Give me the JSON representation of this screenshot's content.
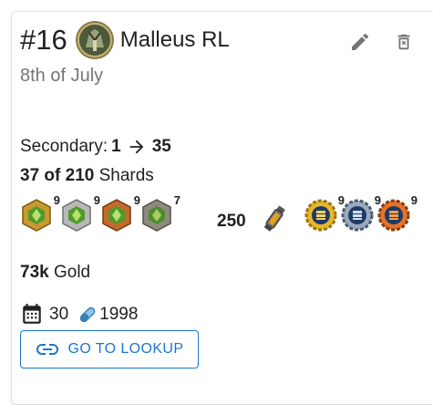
{
  "header": {
    "rank": "#16",
    "champion_name": "Malleus RL",
    "date": "8th of July"
  },
  "secondary": {
    "label": "Secondary:",
    "from": "1",
    "to": "35"
  },
  "shards": {
    "amount": "37 of 210",
    "label": "Shards"
  },
  "crystals": [
    {
      "icon": "green-gold-crystal-icon",
      "count": "9"
    },
    {
      "icon": "green-silver-crystal-icon",
      "count": "9"
    },
    {
      "icon": "green-bronze-crystal-icon",
      "count": "9"
    },
    {
      "icon": "green-iron-crystal-icon",
      "count": "7"
    }
  ],
  "token": {
    "amount": "250",
    "icon": "potion-vial-icon"
  },
  "coins": [
    {
      "icon": "gold-gear-coin-icon",
      "count": "9"
    },
    {
      "icon": "blue-gear-coin-icon",
      "count": "9"
    },
    {
      "icon": "orange-gear-coin-icon",
      "count": "9"
    }
  ],
  "gold": {
    "amount": "73k",
    "label": "Gold"
  },
  "stats": {
    "days": "30",
    "pills": "1998"
  },
  "lookup_button": "GO TO LOOKUP",
  "colors": {
    "accent": "#1976d2",
    "muted": "#757575"
  }
}
